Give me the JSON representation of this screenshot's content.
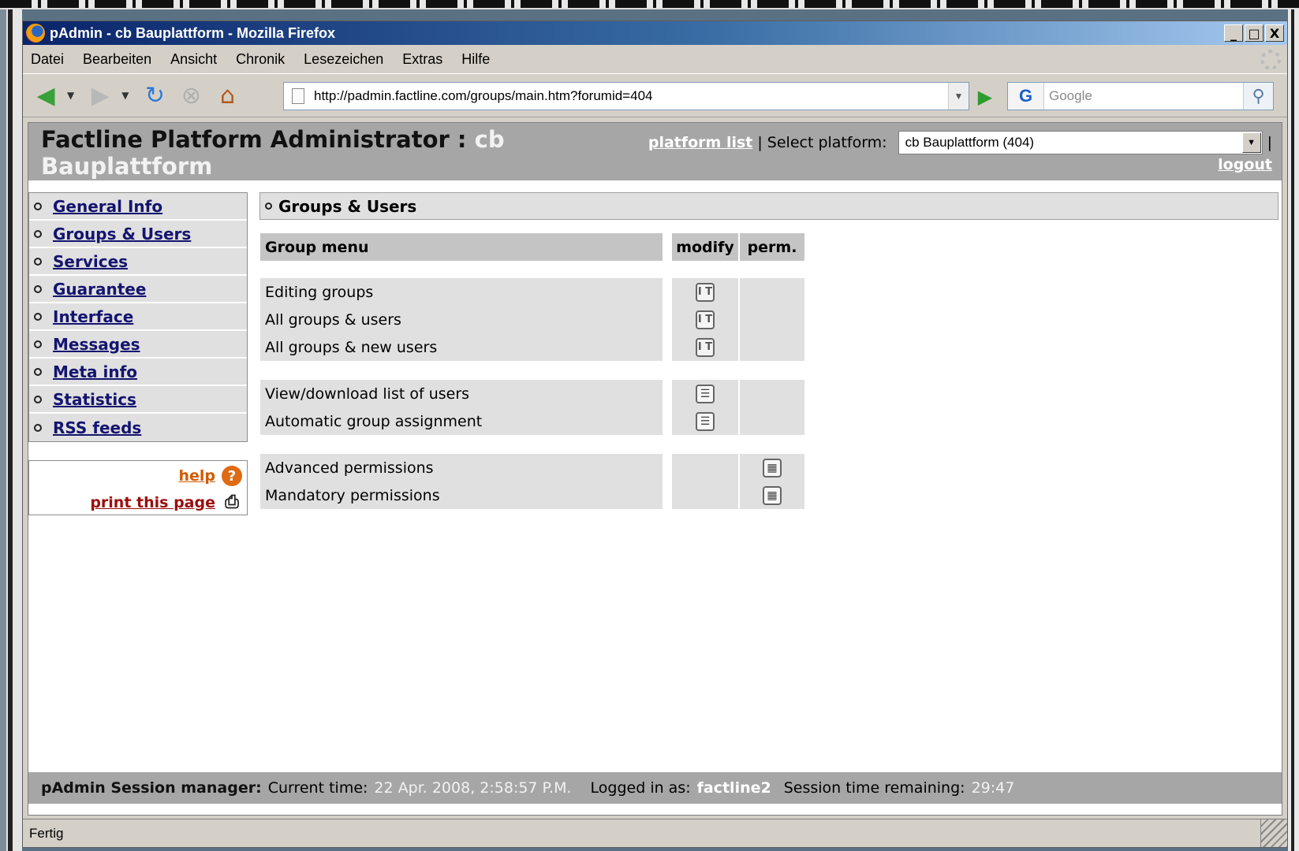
{
  "browser": {
    "window_title": "pAdmin - cb Bauplattform - Mozilla Firefox",
    "window_buttons": {
      "minimize": "_",
      "maximize": "□",
      "close": "X"
    },
    "menu": [
      "Datei",
      "Bearbeiten",
      "Ansicht",
      "Chronik",
      "Lesezeichen",
      "Extras",
      "Hilfe"
    ],
    "url": "http://padmin.factline.com/groups/main.htm?forumid=404",
    "search_placeholder": "Google",
    "search_engine_glyph": "G",
    "status": "Fertig"
  },
  "icons": {
    "back": "back-arrow-icon",
    "forward": "forward-arrow-icon",
    "reload": "reload-icon",
    "stop": "stop-icon",
    "home": "home-icon",
    "go": "go-icon",
    "search": "magnifier-icon",
    "help": "help-icon",
    "print": "printer-icon",
    "modify": "modify-icon",
    "list": "list-icon",
    "permissions": "permissions-grid-icon"
  },
  "header": {
    "title_prefix": "Factline Platform Administrator : ",
    "platform_name": "cb Bauplattform",
    "platform_list_link": "platform list",
    "separator": "|",
    "select_label": "Select platform:",
    "selected_platform": "cb Bauplattform (404)",
    "logout": "logout"
  },
  "sidebar": {
    "items": [
      {
        "label": "General Info"
      },
      {
        "label": "Groups & Users"
      },
      {
        "label": "Services"
      },
      {
        "label": "Guarantee"
      },
      {
        "label": "Interface"
      },
      {
        "label": "Messages"
      },
      {
        "label": "Meta info"
      },
      {
        "label": "Statistics"
      },
      {
        "label": "RSS feeds"
      }
    ],
    "help_link": "help",
    "print_link": "print this page"
  },
  "main": {
    "section_title": "Groups & Users",
    "columns": {
      "name": "Group menu",
      "modify": "modify",
      "perm": "perm."
    },
    "rows": [
      {
        "label": "Editing groups",
        "modify": "modify-icon",
        "perm": ""
      },
      {
        "label": "All groups & users",
        "modify": "modify-icon",
        "perm": ""
      },
      {
        "label": "All groups & new users",
        "modify": "modify-icon",
        "perm": ""
      },
      {
        "label": "View/download list of users",
        "modify": "list-icon",
        "perm": ""
      },
      {
        "label": "Automatic group assignment",
        "modify": "list-icon",
        "perm": ""
      },
      {
        "label": "Advanced permissions",
        "modify": "",
        "perm": "permissions-grid-icon"
      },
      {
        "label": "Mandatory permissions",
        "modify": "",
        "perm": "permissions-grid-icon"
      }
    ]
  },
  "footer": {
    "session_label": "pAdmin Session manager:",
    "current_time_label": "Current time:",
    "current_time": "22 Apr. 2008, 2:58:57 P.M.",
    "logged_in_label": "Logged in as:",
    "user": "factline2",
    "remaining_label": "Session time remaining:",
    "remaining": "29:47"
  }
}
